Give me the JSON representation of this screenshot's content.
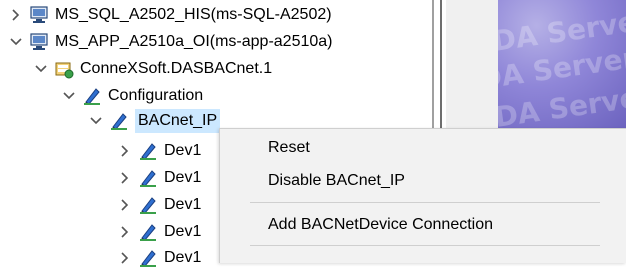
{
  "tree": {
    "items": [
      {
        "label": "MS_SQL_A2502_HIS(ms-SQL-A2502)",
        "expanded": false,
        "icon": "server-icon"
      },
      {
        "label": "MS_APP_A2510a_OI(ms-app-a2510a)",
        "expanded": true,
        "icon": "server-icon"
      },
      {
        "label": "ConneXSoft.DASBACnet.1",
        "expanded": true,
        "icon": "das-server-icon"
      },
      {
        "label": "Configuration",
        "expanded": true,
        "icon": "config-pen-icon"
      },
      {
        "label": "BACnet_IP",
        "expanded": true,
        "selected": true,
        "icon": "config-pen-icon"
      },
      {
        "label": "Dev1",
        "expanded": false,
        "icon": "config-pen-icon"
      },
      {
        "label": "Dev1",
        "expanded": false,
        "icon": "config-pen-icon"
      },
      {
        "label": "Dev1",
        "expanded": false,
        "icon": "config-pen-icon"
      },
      {
        "label": "Dev1",
        "expanded": false,
        "icon": "config-pen-icon"
      },
      {
        "label": "Dev1",
        "expanded": false,
        "icon": "config-pen-icon"
      }
    ]
  },
  "context_menu": {
    "items": [
      {
        "label": "Reset"
      },
      {
        "label": "Disable BACnet_IP"
      },
      {
        "label": "Add BACNetDevice Connection"
      }
    ]
  },
  "banner": {
    "watermark": "DA Server"
  },
  "colors": {
    "selection": "#cce8ff",
    "banner": "#8f86d8",
    "menu_bg": "#f2f2f2"
  }
}
